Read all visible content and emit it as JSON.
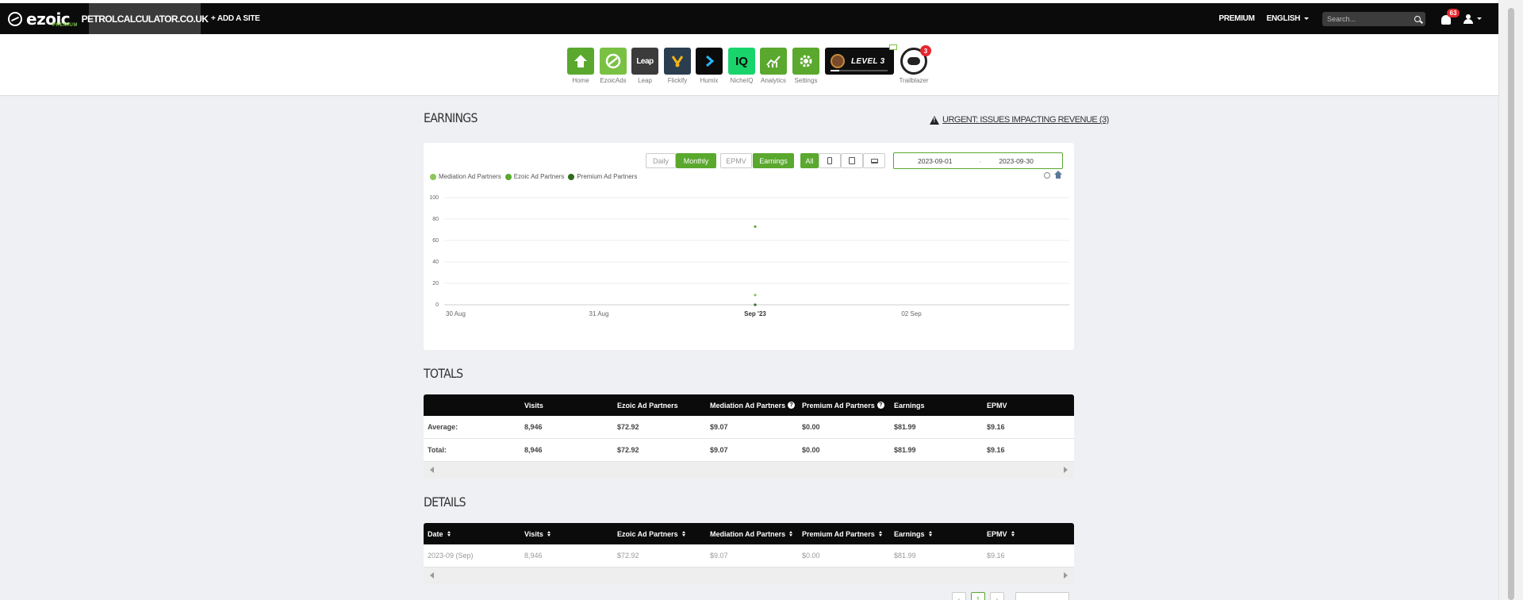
{
  "topbar": {
    "logo_text": "ezoic",
    "logo_sub": "PREMIUM",
    "site_name": "PETROLCALCULATOR.CO.UK",
    "add_site": "+ ADD A SITE",
    "premium": "PREMIUM",
    "language": "ENGLISH",
    "search_placeholder": "Search...",
    "notification_count": "63"
  },
  "apps": [
    {
      "label": "Home",
      "icon": "home-icon",
      "color": "#5aa82e"
    },
    {
      "label": "EzoicAds",
      "icon": "ezoicads-icon",
      "color": "#7ac143"
    },
    {
      "label": "Leap",
      "icon": "leap-icon",
      "tile_text": "Leap",
      "color": "#3b3b3b"
    },
    {
      "label": "Flickify",
      "icon": "flickify-icon",
      "color": "#2b3e50"
    },
    {
      "label": "Humix",
      "icon": "humix-icon",
      "color": "#0b0b0b"
    },
    {
      "label": "NicheIQ",
      "icon": "nicheiq-icon",
      "tile_text": "IQ",
      "color": "#19d46b"
    },
    {
      "label": "Analytics",
      "icon": "analytics-icon",
      "color": "#5aa82e"
    },
    {
      "label": "Settings",
      "icon": "gear-icon",
      "color": "#5aa82e"
    }
  ],
  "level": {
    "text": "LEVEL 3",
    "progress": 0.15
  },
  "trailblazer": {
    "label": "Trailblazer",
    "badge": "3"
  },
  "earnings": {
    "title": "EARNINGS",
    "urgent_link": "URGENT: ISSUES IMPACTING REVENUE (3)",
    "buttons": {
      "daily": "Daily",
      "monthly": "Monthly",
      "epmv": "EPMV",
      "earnings": "Earnings",
      "all": "All"
    },
    "date_from": "2023-09-01",
    "date_sep": "-",
    "date_to": "2023-09-30"
  },
  "chart_data": {
    "type": "scatter",
    "series": [
      {
        "name": "Mediation Ad Partners",
        "color": "#8dc55a",
        "values": [
          {
            "x": "Sep '23",
            "y": 9.07
          }
        ]
      },
      {
        "name": "Ezoic Ad Partners",
        "color": "#5aa82e",
        "values": [
          {
            "x": "Sep '23",
            "y": 72.92
          }
        ]
      },
      {
        "name": "Premium Ad Partners",
        "color": "#2e6b1a",
        "values": [
          {
            "x": "Sep '23",
            "y": 0
          }
        ]
      }
    ],
    "x_ticks": [
      "30 Aug",
      "31 Aug",
      "Sep '23",
      "02 Sep"
    ],
    "y_ticks": [
      0,
      20,
      40,
      60,
      80,
      100
    ],
    "ylim": [
      0,
      100
    ],
    "grid": true,
    "legend_position": "top-left"
  },
  "totals": {
    "title": "TOTALS",
    "headers": [
      "",
      "Visits",
      "Ezoic Ad Partners",
      "Mediation Ad Partners",
      "Premium Ad Partners",
      "Earnings",
      "EPMV"
    ],
    "rows": [
      [
        "Average:",
        "8,946",
        "$72.92",
        "$9.07",
        "$0.00",
        "$81.99",
        "$9.16"
      ],
      [
        "Total:",
        "8,946",
        "$72.92",
        "$9.07",
        "$0.00",
        "$81.99",
        "$9.16"
      ]
    ]
  },
  "details": {
    "title": "DETAILS",
    "headers": [
      "Date",
      "Visits",
      "Ezoic Ad Partners",
      "Mediation Ad Partners",
      "Premium Ad Partners",
      "Earnings",
      "EPMV"
    ],
    "rows": [
      [
        "2023-09 (Sep)",
        "8,946",
        "$72.92",
        "$9.07",
        "$0.00",
        "$81.99",
        "$9.16"
      ]
    ],
    "pager": {
      "prev": "‹",
      "current": "1",
      "next": "›"
    }
  }
}
